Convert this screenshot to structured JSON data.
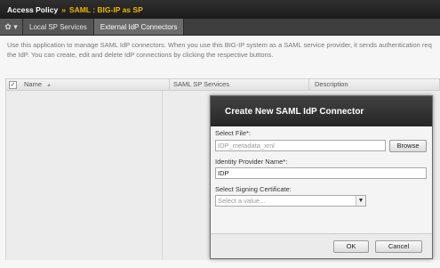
{
  "header": {
    "section": "Access Policy",
    "separator": "»",
    "current": "SAML : BIG-IP as SP"
  },
  "toolbar": {
    "gear_icon": "gear-icon",
    "gear_glyph": "✿ ▾"
  },
  "tabs": [
    {
      "label": "Local SP Services",
      "active": false
    },
    {
      "label": "External IdP Connectors",
      "active": true
    }
  ],
  "description": {
    "line1": "Use this application to manage SAML IdP connectors. When you use this BIG-IP system as a SAML service provider, it sends authentication req",
    "line2": "the IdP. You can create, edit and delete IdP connections by clicking the respective buttons."
  },
  "table": {
    "select_all_glyph": "✓",
    "columns": [
      "Name",
      "SAML SP Services",
      "Description"
    ],
    "sort_glyph": "▲"
  },
  "dialog": {
    "title": "Create New SAML IdP Connector",
    "select_file_label": "Select File*:",
    "select_file_value": "IDP_metadata_xml",
    "browse_label": "Browse",
    "idp_name_label": "Identity Provider Name*:",
    "idp_name_value": "IDP",
    "signing_cert_label": "Select Signing Certificate:",
    "signing_cert_placeholder": "Select a value...",
    "ok_label": "OK",
    "cancel_label": "Cancel"
  }
}
